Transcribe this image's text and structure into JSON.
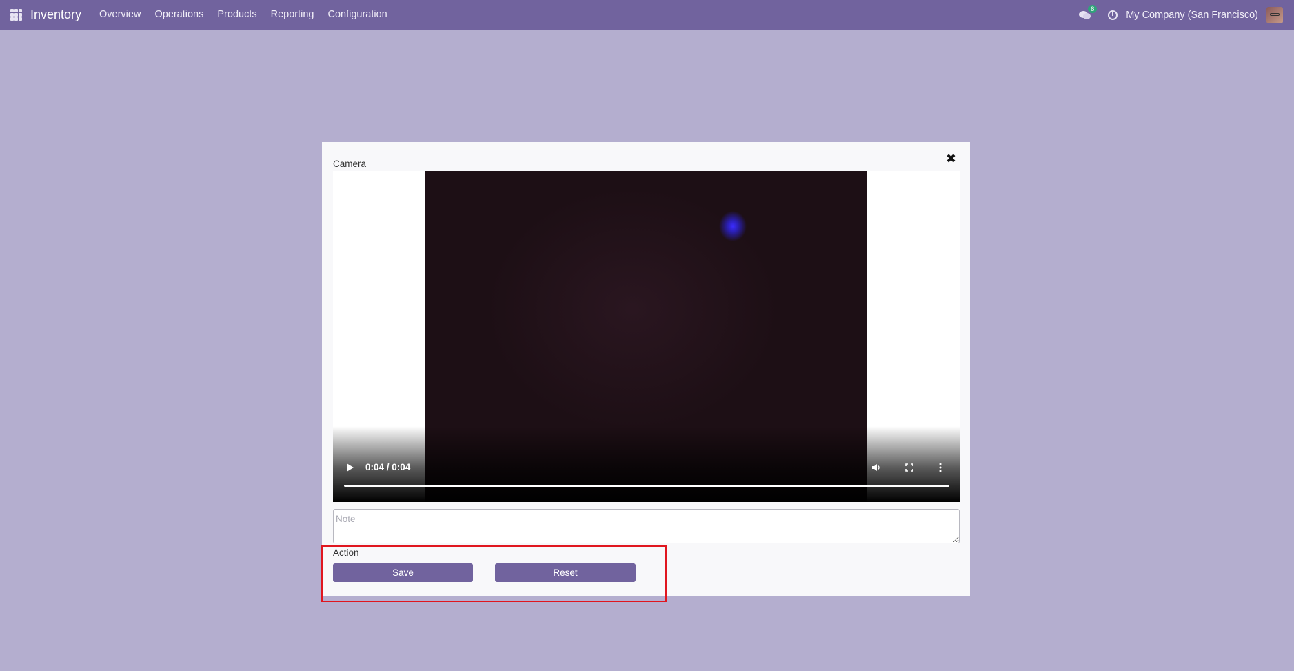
{
  "navbar": {
    "apps_icon": "grid-icon",
    "brand": "Inventory",
    "menu": [
      "Overview",
      "Operations",
      "Products",
      "Reporting",
      "Configuration"
    ],
    "chat_icon": "chat-icon",
    "chat_badge": "8",
    "activity_icon": "clock-icon",
    "company": "My Company (San Francisco)"
  },
  "modal": {
    "close_icon": "close-icon",
    "camera_label": "Camera",
    "video": {
      "time": "0:04 / 0:04",
      "progress": 1.0,
      "icons": [
        "play-icon",
        "volume-icon",
        "fullscreen-icon",
        "more-icon"
      ]
    },
    "note_placeholder": "Note",
    "note_value": "",
    "action_label": "Action",
    "save_label": "Save",
    "reset_label": "Reset"
  },
  "colors": {
    "navbar": "#71639e",
    "background": "#b4aecf",
    "button": "#71639e",
    "badge": "#2fa37a",
    "highlight": "#e0161f"
  }
}
